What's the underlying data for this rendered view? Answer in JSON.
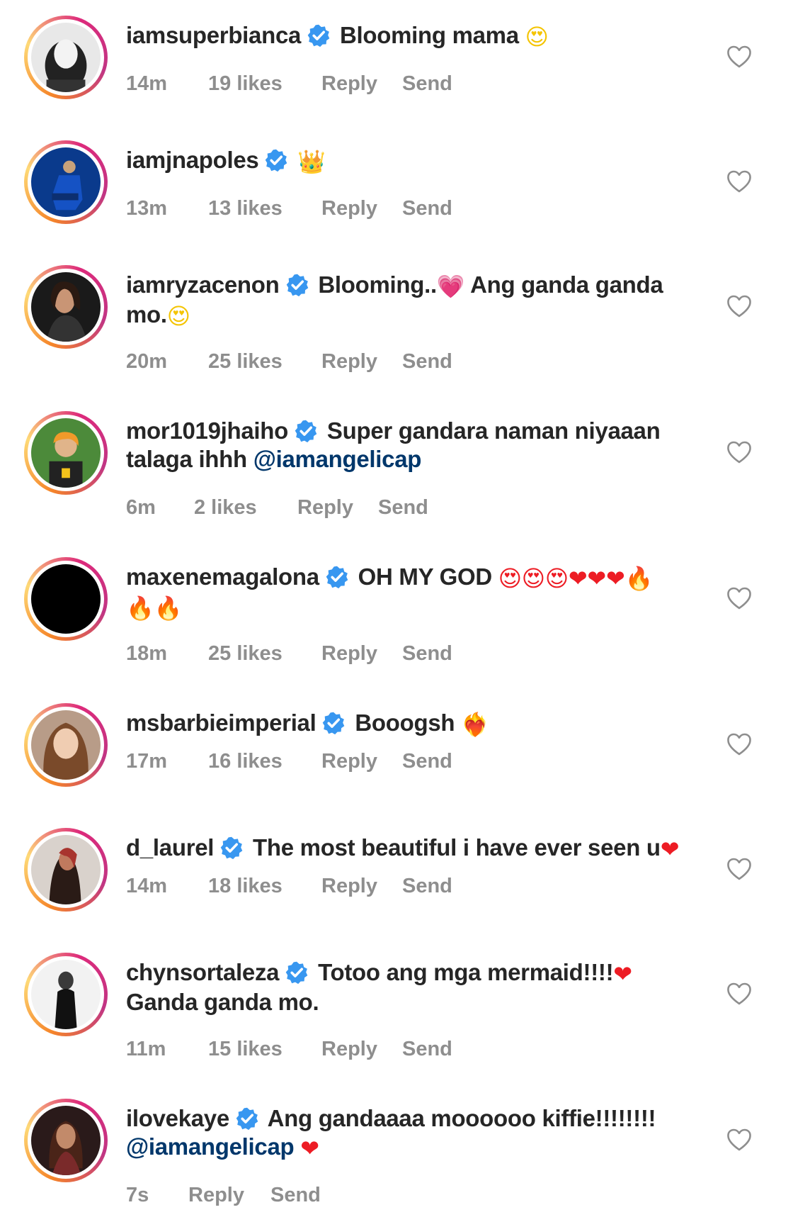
{
  "comments": [
    {
      "username": "iamsuperbianca",
      "text_lines": [
        "Blooming mama"
      ],
      "emoji_after": [
        "😍"
      ],
      "time": "14m",
      "likes": "19 likes",
      "reply": "Reply",
      "send": "Send"
    },
    {
      "username": "iamjnapoles",
      "text_lines": [
        ""
      ],
      "emoji_after": [
        "👑"
      ],
      "time": "13m",
      "likes": "13 likes",
      "reply": "Reply",
      "send": "Send"
    },
    {
      "username": "iamryzacenon",
      "text_part1": "Blooming..",
      "text_part2": "Ang ganda ganda",
      "line2": "mo.",
      "emoji_mid": "💗",
      "emoji_end": "😍",
      "time": "20m",
      "likes": "25 likes",
      "reply": "Reply",
      "send": "Send"
    },
    {
      "username": "mor1019jhaiho",
      "line1": "Super gandara naman niyaaan",
      "line2": "talaga ihhh",
      "mention": "@iamangelicap",
      "time": "6m",
      "likes": "2 likes",
      "reply": "Reply",
      "send": "Send"
    },
    {
      "username": "maxenemagalona",
      "line1": "OH MY GOD",
      "emoji_line1": "😍😍😍❤❤❤🔥",
      "emoji_line2": "🔥🔥",
      "time": "18m",
      "likes": "25 likes",
      "reply": "Reply",
      "send": "Send"
    },
    {
      "username": "msbarbieimperial",
      "line1": "Booogsh",
      "emoji": "❤‍🔥",
      "time": "17m",
      "likes": "16 likes",
      "reply": "Reply",
      "send": "Send"
    },
    {
      "username": "d_laurel",
      "line1": "The most beautiful i have ever seen u",
      "emoji": "❤",
      "time": "14m",
      "likes": "18 likes",
      "reply": "Reply",
      "send": "Send"
    },
    {
      "username": "chynsortaleza",
      "line1": "Totoo ang mga mermaid!!!!",
      "emoji": "❤",
      "line2": "Ganda ganda mo.",
      "time": "11m",
      "likes": "15 likes",
      "reply": "Reply",
      "send": "Send"
    },
    {
      "username": "ilovekaye",
      "line1": "Ang gandaaaa moooooo kiffie!!!!!!!!",
      "mention": "@iamangelicap",
      "emoji": "❤",
      "time": "7s",
      "reply": "Reply",
      "send": "Send"
    }
  ],
  "icons": {
    "verified": "verified-badge-icon",
    "like": "heart-outline-icon"
  },
  "colors": {
    "text": "#262626",
    "meta": "#8e8e8e",
    "mention": "#00376b",
    "verified": "#3897f0"
  }
}
